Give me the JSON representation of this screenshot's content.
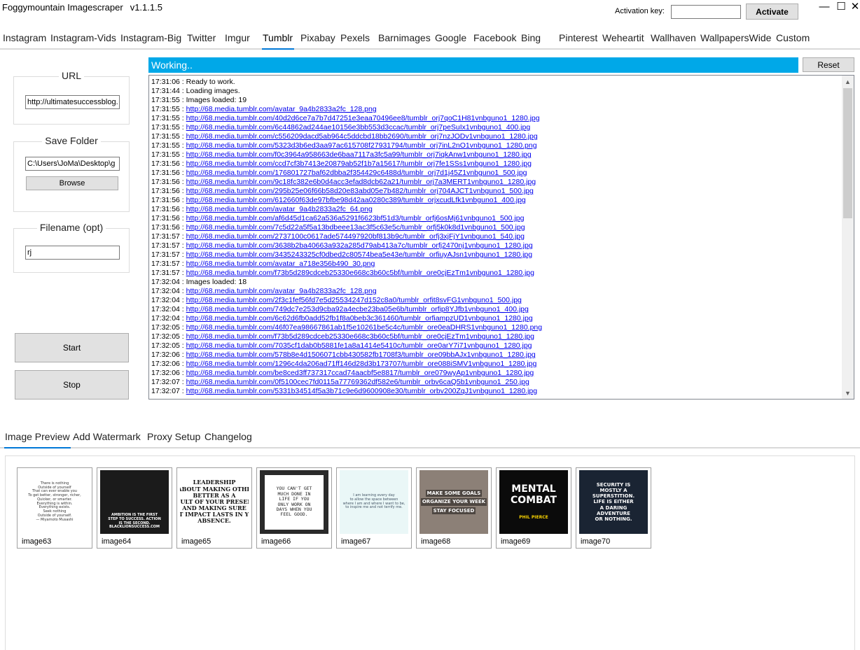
{
  "app": {
    "title": "Foggymountain Imagescraper",
    "version": "v1.1.1.5"
  },
  "activation": {
    "label": "Activation key:",
    "value": "",
    "button": "Activate"
  },
  "window_controls": {
    "minimize": "—",
    "maximize": "☐",
    "close": "✕"
  },
  "source_tabs": [
    "Instagram",
    "Instagram-Vids",
    "Instagram-Big",
    "Twitter",
    "Imgur",
    "Tumblr",
    "Pixabay",
    "Pexels",
    "Barnimages",
    "Google",
    "Facebook",
    "Bing",
    "Pinterest",
    "Weheartit",
    "Wallhaven",
    "WallpapersWide",
    "Custom"
  ],
  "active_source_tab": "Tumblr",
  "url_group": {
    "title": "URL",
    "value": "http://ultimatesuccessblog."
  },
  "save_group": {
    "title": "Save Folder",
    "value": "C:\\Users\\JoMa\\Desktop\\g",
    "browse": "Browse"
  },
  "filename_group": {
    "title": "Filename (opt)",
    "value": "rj"
  },
  "controls": {
    "start": "Start",
    "stop": "Stop"
  },
  "status": {
    "text": "Working..",
    "reset": "Reset"
  },
  "log": [
    {
      "time": "17:31:06",
      "text": "Ready to work.",
      "link": false
    },
    {
      "time": "17:31:44",
      "text": "Loading images.",
      "link": false
    },
    {
      "time": "17:31:55",
      "text": "Images loaded: 19",
      "link": false
    },
    {
      "time": "17:31:55",
      "text": "http://68.media.tumblr.com/avatar_9a4b2833a2fc_128.png",
      "link": true
    },
    {
      "time": "17:31:55",
      "text": "http://68.media.tumblr.com/40d2d6ce7a7b7d47251e3eaa70496ee8/tumblr_orj7qoC1H81vnbguno1_1280.jpg",
      "link": true
    },
    {
      "time": "17:31:55",
      "text": "http://68.media.tumblr.com/6c44862ad244ae10156e3bb553d3ccac/tumblr_orj7peSuIx1vnbguno1_400.jpg",
      "link": true
    },
    {
      "time": "17:31:55",
      "text": "http://68.media.tumblr.com/c556209dacd5ab964c5ddcbd18bb2690/tumblr_orj7nzJODv1vnbguno1_1280.jpg",
      "link": true
    },
    {
      "time": "17:31:55",
      "text": "http://68.media.tumblr.com/5323d3b6ed3aa97ac615708f27931794/tumblr_orj7inL2nO1vnbguno1_1280.png",
      "link": true
    },
    {
      "time": "17:31:55",
      "text": "http://68.media.tumblr.com/f0c3964a958663de6baa7117a3fc5a99/tumblr_orj7iqkAnw1vnbguno1_1280.jpg",
      "link": true
    },
    {
      "time": "17:31:56",
      "text": "http://68.media.tumblr.com/ccd7cf3b7413e20879ab52f1b7a15617/tumblr_orj7fe1SSs1vnbguno1_1280.jpg",
      "link": true
    },
    {
      "time": "17:31:56",
      "text": "http://68.media.tumblr.com/176801727baf62dbba2f354429c6488d/tumblr_orj7d1j45Z1vnbguno1_500.jpg",
      "link": true
    },
    {
      "time": "17:31:56",
      "text": "http://68.media.tumblr.com/9c18fc382e6b0d4acc3efad8dcb62a21/tumblr_orj7a3MERT1vnbguno1_1280.jpg",
      "link": true
    },
    {
      "time": "17:31:56",
      "text": "http://68.media.tumblr.com/295b25e06f66b58d20e83abd05e7b482/tumblr_orj704AJCT1vnbguno1_500.jpg",
      "link": true
    },
    {
      "time": "17:31:56",
      "text": "http://68.media.tumblr.com/612660f63de97bfbe98d42aa0280c389/tumblr_orjxcudLfk1vnbguno1_400.jpg",
      "link": true
    },
    {
      "time": "17:31:56",
      "text": "http://68.media.tumblr.com/avatar_9a4b2833a2fc_64.png",
      "link": true
    },
    {
      "time": "17:31:56",
      "text": "http://68.media.tumblr.com/af6d45d1ca62a536a5291f6623bf51d3/tumblr_orfj6osMj61vnbguno1_500.jpg",
      "link": true
    },
    {
      "time": "17:31:56",
      "text": "http://68.media.tumblr.com/7c5d22a5f5a13bdbeee13ac3f5c63e5c/tumblr_orfj5k0k8d1vnbguno1_500.jpg",
      "link": true
    },
    {
      "time": "17:31:57",
      "text": "http://68.media.tumblr.com/2737100c0617ade574497920bf813b9c/tumblr_orfj3xjFjY1vnbguno1_540.jpg",
      "link": true
    },
    {
      "time": "17:31:57",
      "text": "http://68.media.tumblr.com/3638b2ba40663a932a285d79ab413a7c/tumblr_orfj2470nj1vnbguno1_1280.jpg",
      "link": true
    },
    {
      "time": "17:31:57",
      "text": "http://68.media.tumblr.com/3435243325cf0dbed2c80574bea5e43e/tumblr_orfiuyAJsn1vnbguno1_1280.jpg",
      "link": true
    },
    {
      "time": "17:31:57",
      "text": "http://68.media.tumblr.com/avatar_a718e356b490_30.png",
      "link": true
    },
    {
      "time": "17:31:57",
      "text": "http://68.media.tumblr.com/f73b5d289cdceb25330e668c3b60c5bf/tumblr_ore0cjEzTm1vnbguno1_1280.jpg",
      "link": true
    },
    {
      "time": "17:32:04",
      "text": "Images loaded: 18",
      "link": false
    },
    {
      "time": "17:32:04",
      "text": "http://68.media.tumblr.com/avatar_9a4b2833a2fc_128.png",
      "link": true
    },
    {
      "time": "17:32:04",
      "text": "http://68.media.tumblr.com/2f3c1fef56fd7e5d25534247d152c8a0/tumblr_orfit8svFG1vnbguno1_500.jpg",
      "link": true
    },
    {
      "time": "17:32:04",
      "text": "http://68.media.tumblr.com/749dc7e253d9cba92a4ecbe23ba05e6b/tumblr_orfip8YJfb1vnbguno1_400.jpg",
      "link": true
    },
    {
      "time": "17:32:04",
      "text": "http://68.media.tumblr.com/6c62d6fb0add52fb1f8a0beb3c361460/tumblr_orfiampzUD1vnbguno1_1280.jpg",
      "link": true
    },
    {
      "time": "17:32:05",
      "text": "http://68.media.tumblr.com/46f07ea98667861ab1f5e10261be5c4c/tumblr_ore0eaDHRS1vnbguno1_1280.png",
      "link": true
    },
    {
      "time": "17:32:05",
      "text": "http://68.media.tumblr.com/f73b5d289cdceb25330e668c3b60c5bf/tumblr_ore0cjEzTm1vnbguno1_1280.jpg",
      "link": true
    },
    {
      "time": "17:32:05",
      "text": "http://68.media.tumblr.com/7035cf1dab0b5881fe1a8a1414e5410c/tumblr_ore0arY7i71vnbguno1_1280.jpg",
      "link": true
    },
    {
      "time": "17:32:06",
      "text": "http://68.media.tumblr.com/578b8e4d1506071cbb430582fb1708f3/tumblr_ore09bbAJx1vnbguno1_1280.jpg",
      "link": true
    },
    {
      "time": "17:32:06",
      "text": "http://68.media.tumblr.com/1296c4da206ad71ff146d28d3b173707/tumblr_ore088iSMV1vnbguno1_1280.jpg",
      "link": true
    },
    {
      "time": "17:32:06",
      "text": "http://68.media.tumblr.com/be8ced3ff737317ccad74aacbf5e8817/tumblr_ore079wyAp1vnbguno1_1280.jpg",
      "link": true
    },
    {
      "time": "17:32:07",
      "text": "http://68.media.tumblr.com/0f5100cec7fd0115a77769362df582e6/tumblr_orbv6caQ5b1vnbguno1_250.jpg",
      "link": true
    },
    {
      "time": "17:32:07",
      "text": "http://68.media.tumblr.com/5331b34514f5a3b71c9e6d9600908e30/tumblr_orbv200ZqJ1vnbguno1_1280.jpg",
      "link": true
    }
  ],
  "bottom_tabs": [
    "Image Preview",
    "Add Watermark",
    "Proxy Setup",
    "Changelog"
  ],
  "active_bottom_tab": "Image Preview",
  "thumbnails": [
    {
      "label": "image63",
      "bg": "#ffffff",
      "fg": "#333333",
      "lines": [
        "There is nothing",
        "Outside of yourself",
        "That can ever enable you",
        "To get better, stronger, richer,",
        "Quicker, or smarter.",
        "Everything is within.",
        "Everything exists.",
        "Seek nothing",
        "Outside of yourself.",
        "— Miyamoto Musashi"
      ],
      "style": "small"
    },
    {
      "label": "image64",
      "bg": "#1b1b1b",
      "fg": "#ffffff",
      "lines": [
        "AMBITION IS THE FIRST",
        "STEP TO SUCCESS. ACTION",
        "IS THE SECOND.",
        "BLACKLIONSUCCESS.COM"
      ],
      "style": "photo"
    },
    {
      "label": "image65",
      "bg": "#ffffff",
      "fg": "#111111",
      "lines": [
        "LEADERSHIP",
        "IS ABOUT MAKING OTHERS",
        "BETTER AS A",
        "RESULT OF YOUR PRESENCE",
        "AND MAKING SURE",
        "THAT IMPACT LASTS IN YOUR",
        "ABSENCE."
      ],
      "style": "bold"
    },
    {
      "label": "image66",
      "bg": "#2a2a2a",
      "fg": "#222222",
      "lines": [
        "YOU CAN'T GET",
        "MUCH DONE IN",
        "LIFE IF YOU",
        "ONLY WORK ON",
        "DAYS WHEN YOU",
        "FEEL GOOD."
      ],
      "style": "boxed"
    },
    {
      "label": "image67",
      "bg": "#eaf7f7",
      "fg": "#456",
      "lines": [
        "I am learning every day",
        "to allow the space between",
        "where I am and where I want to be,",
        "to inspire me and not terrify me."
      ],
      "style": "water"
    },
    {
      "label": "image68",
      "bg": "#8c8077",
      "fg": "#ffffff",
      "lines": [
        "MAKE SOME GOALS",
        "ORGANIZE YOUR WEEK",
        "STAY FOCUSED"
      ],
      "style": "desk"
    },
    {
      "label": "image69",
      "bg": "#0b0b0b",
      "fg": "#ffffff",
      "lines": [
        "MENTAL",
        "COMBAT",
        "PHIL PIERCE"
      ],
      "style": "mental"
    },
    {
      "label": "image70",
      "bg": "#1a2433",
      "fg": "#ffffff",
      "lines": [
        "SECURITY IS",
        "MOSTLY A",
        "SUPERSTITION.",
        "LIFE IS EITHER",
        "A DARING",
        "ADVENTURE",
        "OR NOTHING."
      ],
      "style": "sunset"
    }
  ],
  "colors": {
    "accent": "#0078d7",
    "status_bg": "#00a8e8",
    "link": "#0000ee"
  }
}
